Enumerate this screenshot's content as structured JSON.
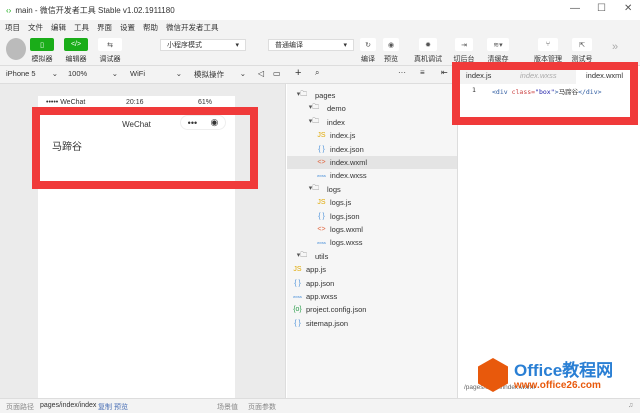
{
  "window": {
    "title": "main - 微信开发者工具 Stable v1.02.1911180",
    "minimize": "—",
    "maximize": "☐",
    "close": "✕"
  },
  "menu": [
    "项目",
    "文件",
    "编辑",
    "工具",
    "界面",
    "设置",
    "帮助",
    "微信开发者工具"
  ],
  "toolbar": {
    "simulator": "模拟器",
    "editor": "编辑器",
    "debugger": "调试器",
    "mode": "小程序模式",
    "compile_mode": "普通编译",
    "compile": "编译",
    "preview": "预览",
    "remote_debug": "真机调试",
    "backend": "切后台",
    "clear_cache": "清缓存",
    "version": "版本管理",
    "test": "测试号",
    "more": "»"
  },
  "subtoolbar": {
    "device": "iPhone 5",
    "zoom": "100%",
    "network": "WiFi",
    "operation": "模拟操作"
  },
  "phone": {
    "status_carrier": "••••• WeChat",
    "status_time": "20:16",
    "status_battery": "61%",
    "nav_title": "WeChat",
    "content": "马蹄谷"
  },
  "tree": [
    {
      "name": "pages",
      "type": "folder",
      "depth": 0
    },
    {
      "name": "demo",
      "type": "folder",
      "depth": 1
    },
    {
      "name": "index",
      "type": "folder",
      "depth": 1
    },
    {
      "name": "index.js",
      "type": "js",
      "depth": 2
    },
    {
      "name": "index.json",
      "type": "json",
      "depth": 2
    },
    {
      "name": "index.wxml",
      "type": "wxml",
      "depth": 2,
      "selected": true
    },
    {
      "name": "index.wxss",
      "type": "wxss",
      "depth": 2
    },
    {
      "name": "logs",
      "type": "folder",
      "depth": 1
    },
    {
      "name": "logs.js",
      "type": "js",
      "depth": 2
    },
    {
      "name": "logs.json",
      "type": "json",
      "depth": 2
    },
    {
      "name": "logs.wxml",
      "type": "wxml",
      "depth": 2
    },
    {
      "name": "logs.wxss",
      "type": "wxss",
      "depth": 2
    },
    {
      "name": "utils",
      "type": "folder",
      "depth": 0
    },
    {
      "name": "app.js",
      "type": "js",
      "depth": 0
    },
    {
      "name": "app.json",
      "type": "json",
      "depth": 0
    },
    {
      "name": "app.wxss",
      "type": "wxss",
      "depth": 0
    },
    {
      "name": "project.config.json",
      "type": "cfg",
      "depth": 0
    },
    {
      "name": "sitemap.json",
      "type": "json",
      "depth": 0
    }
  ],
  "editor": {
    "tabs": [
      "index.js",
      "index.wxss",
      "index.wxml"
    ],
    "line_number": "1",
    "code_tag_open": "<div ",
    "code_attr": "class=",
    "code_val": "\"box\"",
    "code_close": ">",
    "code_text": "马蹄谷",
    "code_end": "</div>",
    "breadcrumb": "/pages/index/index.wxml"
  },
  "status": {
    "path_label": "页面路径",
    "path": "pages/index/index",
    "copy": "复制",
    "preview": "预览",
    "scene": "场景值",
    "params": "页面参数"
  },
  "watermark": {
    "text": "Office教程网",
    "url": "www.office26.com"
  },
  "colors": {
    "accent": "#1aad19",
    "highlight": "#f03a3a"
  }
}
